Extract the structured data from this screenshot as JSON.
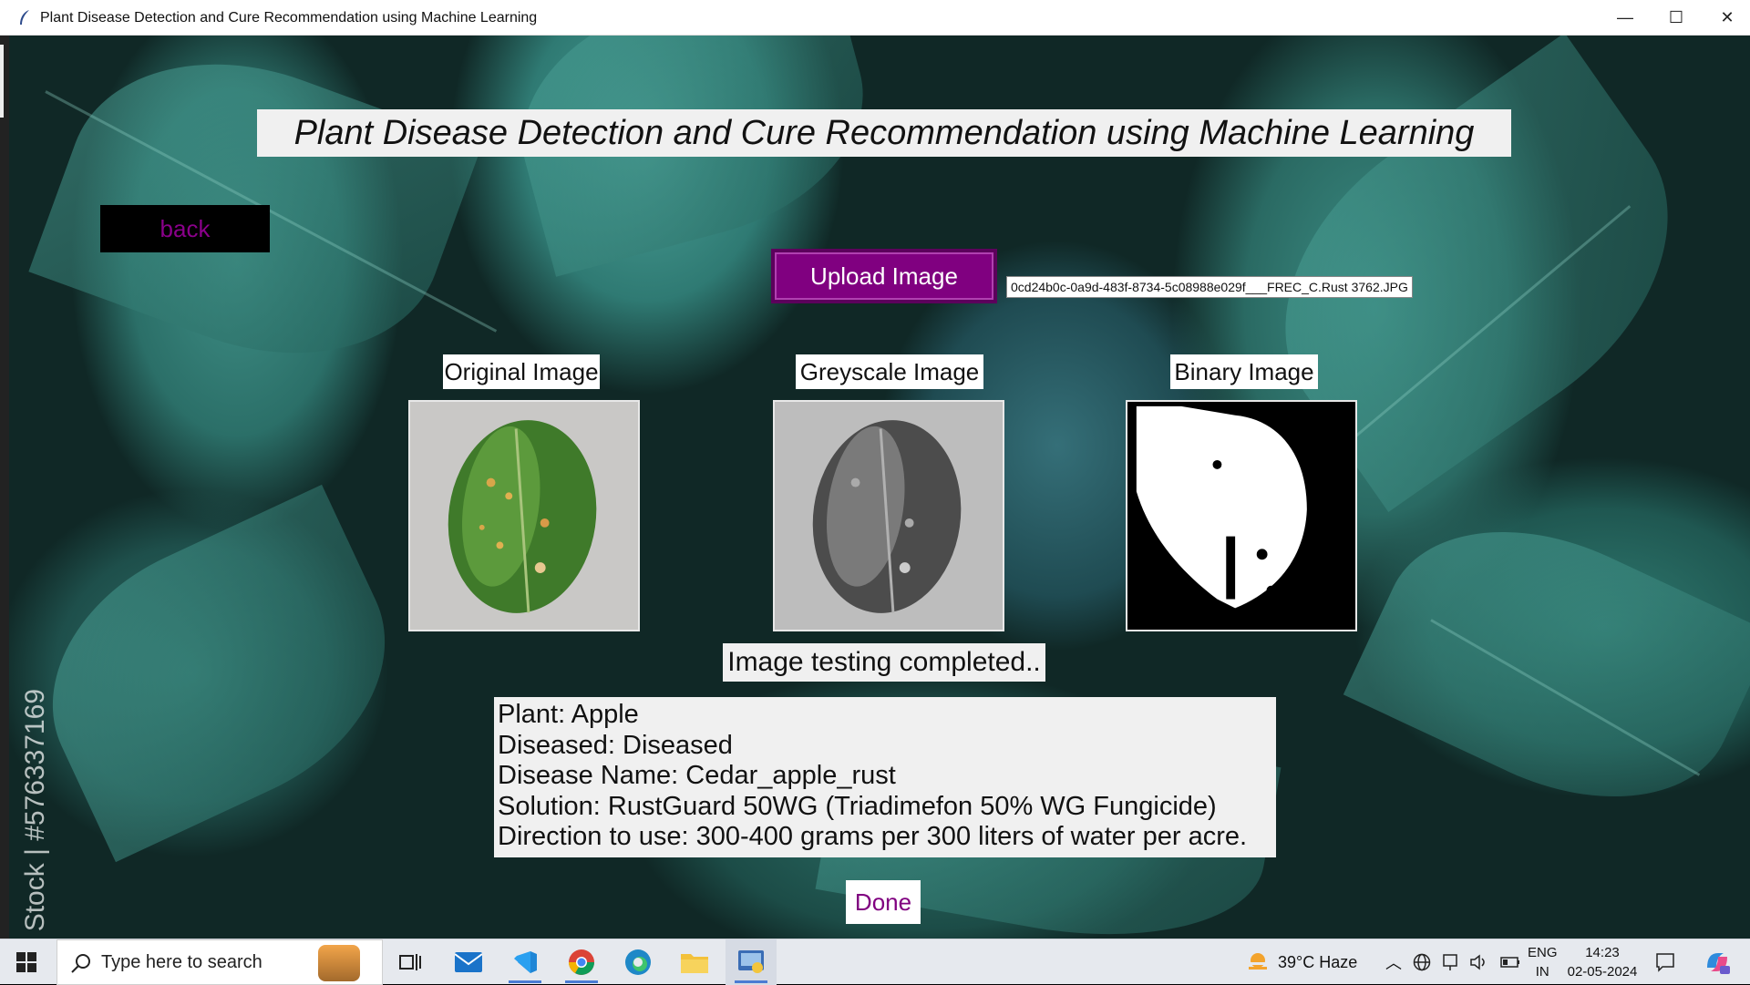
{
  "window": {
    "title": "Plant Disease Detection and Cure Recommendation using Machine Learning",
    "controls": {
      "minimize": "—",
      "maximize": "☐",
      "close": "✕"
    },
    "app_icon": "feather-icon"
  },
  "app": {
    "heading": "Plant Disease Detection and Cure Recommendation using Machine Learning",
    "back_label": "back",
    "upload_label": "Upload Image",
    "filename": "0cd24b0c-0a9d-483f-8734-5c08988e029f___FREC_C.Rust 3762.JPG",
    "images": [
      {
        "label": "Original Image"
      },
      {
        "label": "Greyscale Image"
      },
      {
        "label": "Binary Image"
      }
    ],
    "status": "Image testing completed..",
    "result": {
      "plant": "Plant: Apple",
      "diseased": "Diseased: Diseased",
      "disease_name": "Disease Name: Cedar_apple_rust",
      "solution": "Solution: RustGuard 50WG (Triadimefon 50% WG Fungicide)",
      "direction": "Direction to use: 300-400 grams per 300 liters of water per acre."
    },
    "done_label": "Done",
    "watermark": "be Stock | #576337169",
    "colors": {
      "accent": "#800080",
      "panel": "#f0f0f0"
    }
  },
  "taskbar": {
    "search_placeholder": "Type here to search",
    "weather": "39°C  Haze",
    "lang_top": "ENG",
    "lang_bottom": "IN",
    "time": "14:23",
    "date": "02-05-2024",
    "apps": [
      "task-view-icon",
      "mail-icon",
      "vscode-icon",
      "chrome-icon",
      "edge-icon",
      "file-explorer-icon",
      "python-app-icon"
    ]
  }
}
